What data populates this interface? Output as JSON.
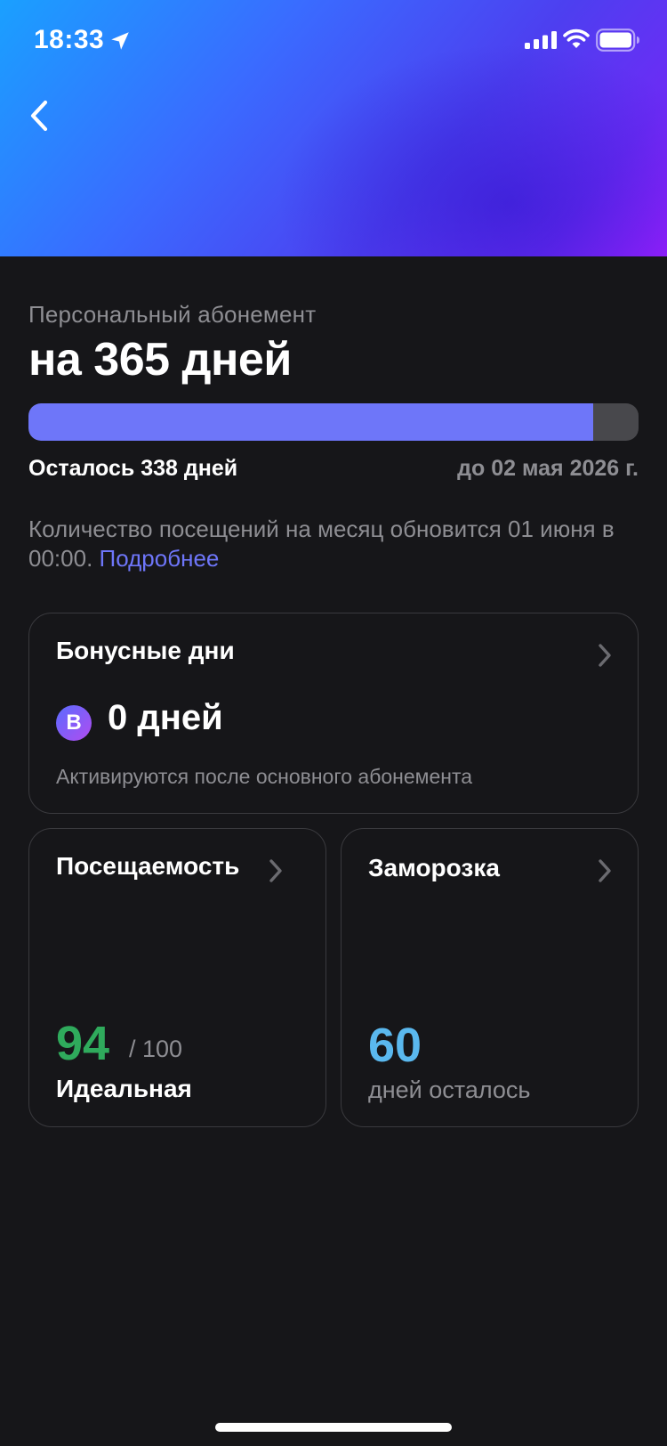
{
  "status_bar": {
    "time": "18:33"
  },
  "subscription": {
    "type_label": "Персональный абонемент",
    "title": "на 365 дней",
    "progress_fraction": 0.926,
    "remaining_text": "Осталось 338 дней",
    "end_date_text": "до 02 мая 2026 г.",
    "visits_note": "Количество посещений на месяц обновится 01 июня в 00:00.",
    "more_link": "Подробнее"
  },
  "bonus_card": {
    "title": "Бонусные дни",
    "badge_letter": "B",
    "value": "0 дней",
    "note": "Активируются после основного абонемента"
  },
  "attendance_card": {
    "title": "Посещаемость",
    "score": "94",
    "max": "/ 100",
    "label": "Идеальная"
  },
  "freeze_card": {
    "title": "Заморозка",
    "value": "60",
    "label": "дней осталось"
  },
  "colors": {
    "accent": "#6e76f9",
    "score_green": "#2faa5c",
    "freeze_blue": "#5ab8ee",
    "background": "#161619"
  }
}
